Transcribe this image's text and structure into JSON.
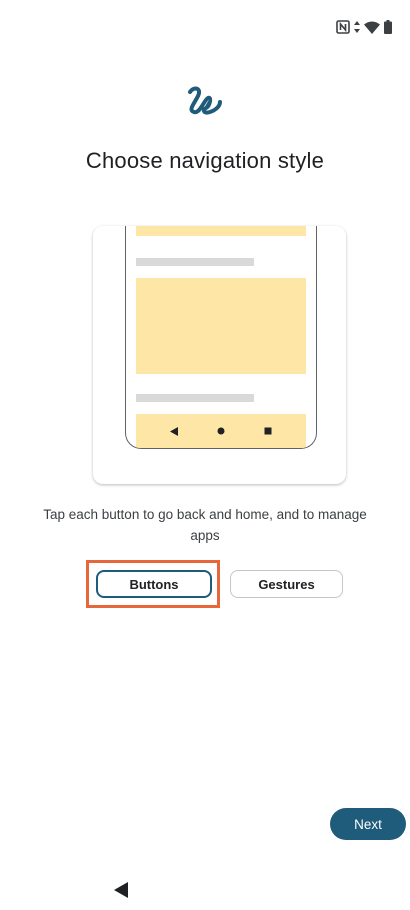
{
  "status_bar": {
    "icons": [
      "nfc-icon",
      "data-arrows-icon",
      "wifi-icon",
      "battery-icon"
    ]
  },
  "logo": {
    "icon": "squiggle-logo-icon",
    "color": "#1f5b7a"
  },
  "page": {
    "title": "Choose navigation style",
    "description": "Tap each button to go back and home, and to manage apps"
  },
  "illustration": {
    "accent_color": "#fde6a6",
    "nav_icons": [
      "back-triangle-icon",
      "home-dot-icon",
      "recents-square-icon"
    ]
  },
  "options": {
    "buttons_label": "Buttons",
    "gestures_label": "Gestures",
    "selected": "Buttons",
    "highlight_color": "#e8673a"
  },
  "footer": {
    "next_label": "Next",
    "next_color": "#1f5b7a"
  },
  "system_nav": {
    "back_icon": "system-back-icon"
  }
}
